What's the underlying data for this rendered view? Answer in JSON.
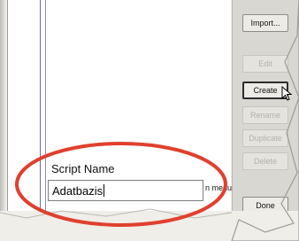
{
  "buttons": {
    "import": "Import...",
    "edit": "Edit",
    "create": "Create",
    "rename": "Rename",
    "duplicate": "Duplicate",
    "delete": "Delete",
    "done": "Done"
  },
  "script_name": {
    "label": "Script Name",
    "value": "Adatbazis"
  },
  "partial_text": "n menu",
  "colors": {
    "highlight_oval": "#e0402e"
  },
  "icons": [
    "mouse-cursor-icon"
  ]
}
